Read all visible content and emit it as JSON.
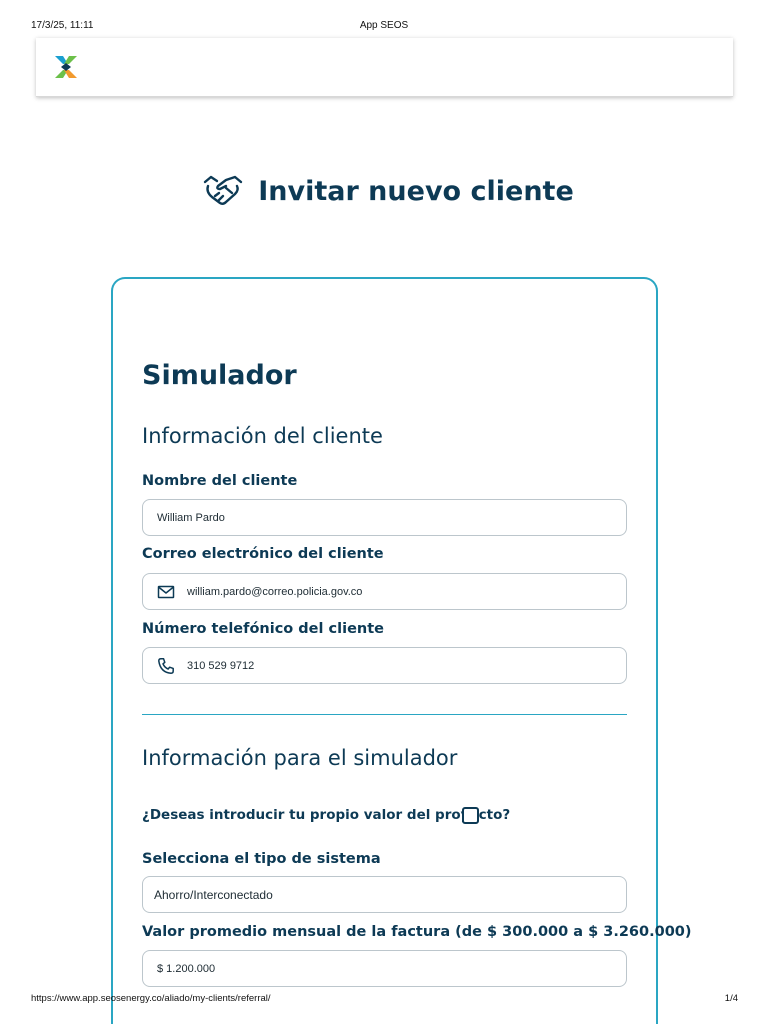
{
  "print_header": {
    "datetime": "17/3/25, 11:11",
    "title": "App SEOS"
  },
  "page": {
    "title": "Invitar nuevo cliente",
    "title_icon": "handshake-icon"
  },
  "card": {
    "heading": "Simulador",
    "client_section": {
      "heading": "Información del cliente",
      "name_label": "Nombre del cliente",
      "name_value": "William Pardo",
      "email_label": "Correo electrónico del cliente",
      "email_value": "william.pardo@correo.policia.gov.co",
      "email_icon": "mail-icon",
      "phone_label": "Número telefónico del cliente",
      "phone_value": "310 529 9712",
      "phone_icon": "phone-icon"
    },
    "sim_section": {
      "heading": "Información para el simulador",
      "own_value_label": "¿Deseas introducir tu propio valor del proyecto?",
      "own_value_checked": false,
      "system_type_label": "Selecciona el tipo de sistema",
      "system_type_value": "Ahorro/Interconectado",
      "bill_label": "Valor promedio mensual de la factura (de $ 300.000 a $ 3.260.000)",
      "bill_value": "$ 1.200.000"
    }
  },
  "print_footer": {
    "url": "https://www.app.seosenergy.co/aliado/my-clients/referral/",
    "page": "1/4"
  },
  "colors": {
    "primary": "#0d3a55",
    "accent": "#2aa6c3",
    "logo_green": "#6cc04a",
    "logo_orange": "#f29a2e",
    "logo_blue": "#1a9fd0"
  }
}
